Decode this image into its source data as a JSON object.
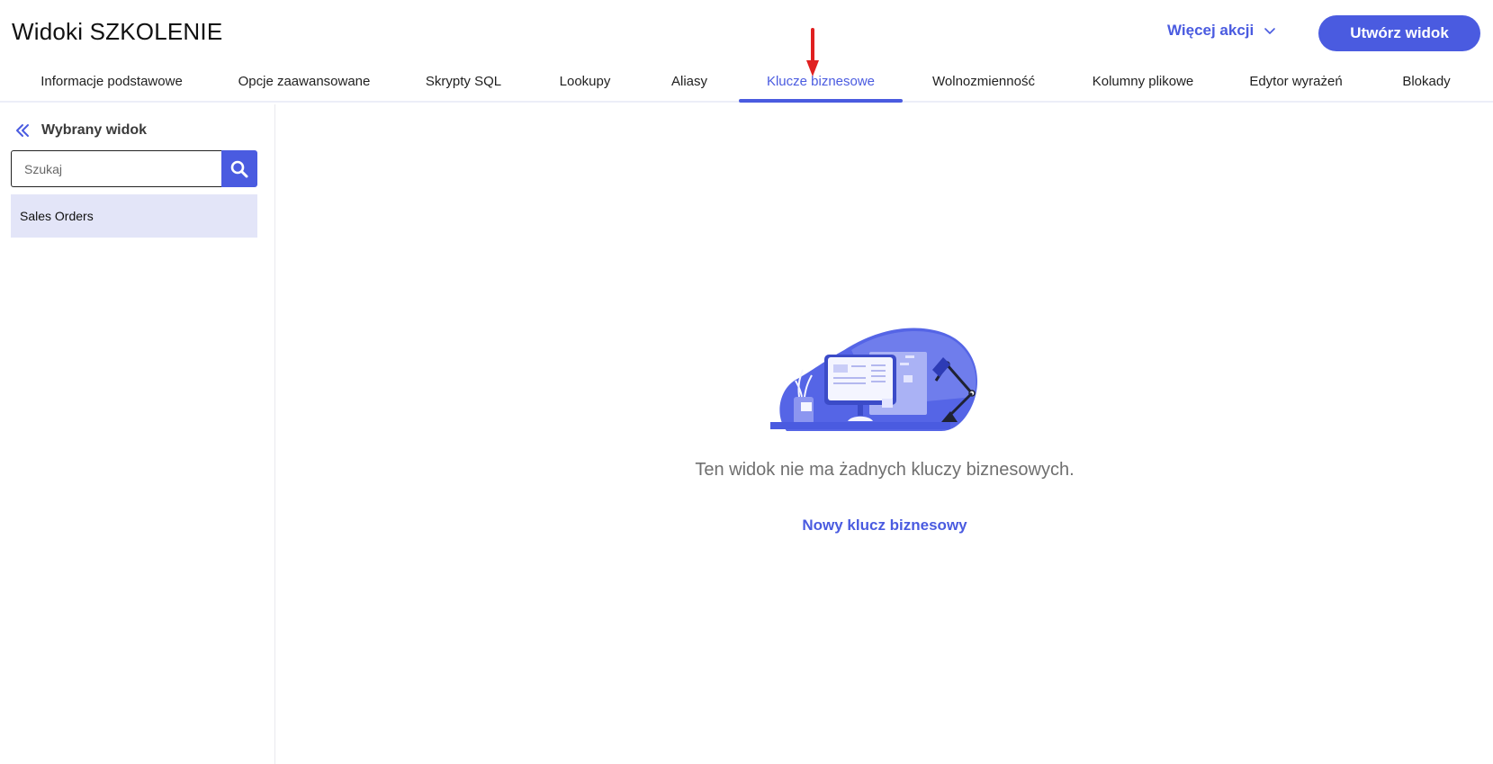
{
  "header": {
    "title": "Widoki SZKOLENIE",
    "more_actions_label": "Więcej akcji",
    "create_button_label": "Utwórz widok"
  },
  "tabs": [
    {
      "label": "Informacje podstawowe",
      "active": false
    },
    {
      "label": "Opcje zaawansowane",
      "active": false
    },
    {
      "label": "Skrypty SQL",
      "active": false
    },
    {
      "label": "Lookupy",
      "active": false
    },
    {
      "label": "Aliasy",
      "active": false
    },
    {
      "label": "Klucze biznesowe",
      "active": true
    },
    {
      "label": "Wolnozmienność",
      "active": false
    },
    {
      "label": "Kolumny plikowe",
      "active": false
    },
    {
      "label": "Edytor wyrażeń",
      "active": false
    },
    {
      "label": "Blokady",
      "active": false
    }
  ],
  "sidebar": {
    "title": "Wybrany widok",
    "search_placeholder": "Szukaj",
    "items": [
      {
        "label": "Sales Orders",
        "selected": true
      }
    ]
  },
  "main": {
    "empty_message": "Ten widok nie ma żadnych kluczy biznesowych.",
    "new_key_link": "Nowy klucz biznesowy"
  },
  "icons": {
    "collapse": "double-chevron-left-icon",
    "search": "search-icon",
    "dropdown": "chevron-down-icon",
    "annotation": "red-arrow-icon"
  },
  "colors": {
    "accent": "#4a5be0",
    "selected_bg": "#e3e5f8",
    "annotation": "#e02020"
  }
}
